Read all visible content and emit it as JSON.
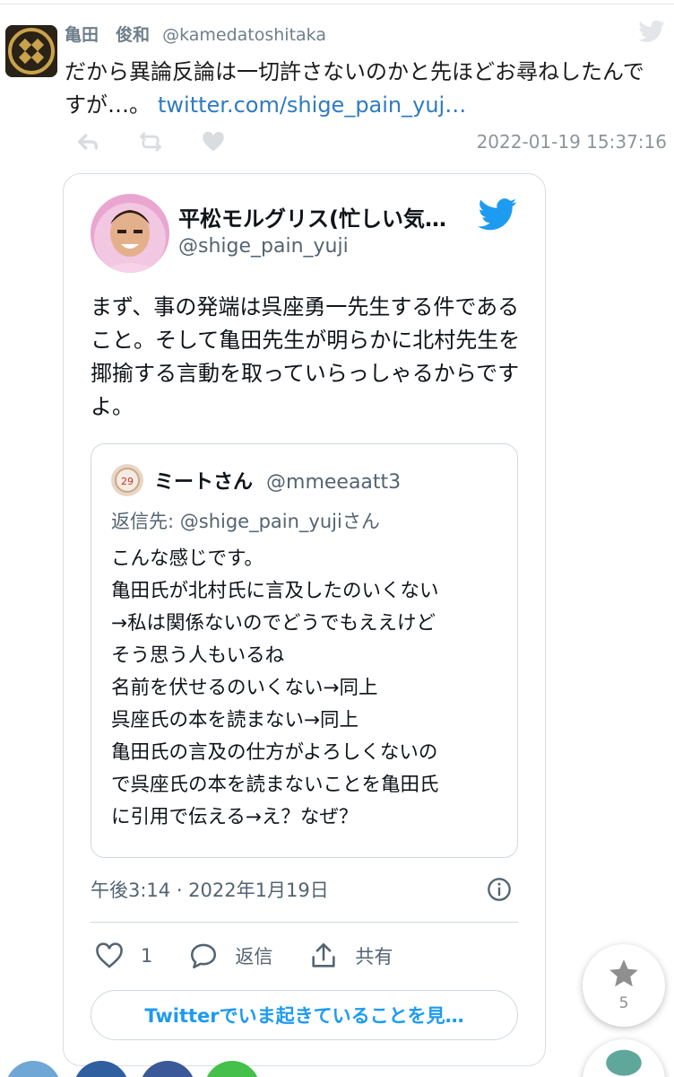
{
  "outer_tweet": {
    "author_name": "亀田　俊和",
    "author_handle": "@kamedatoshitaka",
    "text": "だから異論反論は一切許さないのかと先ほどお尋ねしたんですが…。",
    "link_text": "twitter.com/shige_pain_yuj…",
    "timestamp": "2022-01-19 15:37:16",
    "icons": [
      "reply-icon",
      "retweet-icon",
      "like-icon",
      "twitter-bird-icon"
    ]
  },
  "embedded_tweet": {
    "author_name": "平松モルグリス(忙しい気…",
    "author_handle": "@shige_pain_yuji",
    "text": "まず、事の発端は呉座勇一先生する件であること。そして亀田先生が明らかに北村先生を揶揄する言動を取っていらっしゃるからですよ。",
    "quoted": {
      "author_name": "ミートさん",
      "author_handle": "@mmeeaatt3",
      "reply_to": "返信先: @shige_pain_yujiさん",
      "lines": [
        "こんな感じです。",
        "亀田氏が北村氏に言及したのいくない",
        "→私は関係ないのでどうでもええけど",
        "そう思う人もいるね",
        "名前を伏せるのいくない→同上",
        "呉座氏の本を読まない→同上",
        "亀田氏の言及の仕方がよろしくないの",
        "で呉座氏の本を読まないことを亀田氏",
        "に引用で伝える→え？なぜ？"
      ]
    },
    "date": "午後3:14 · 2022年1月19日",
    "like_count": "1",
    "reply_label": "返信",
    "share_label": "共有",
    "cta_label": "Twitterでいま起きていることを見…"
  },
  "floating": {
    "star_count": "5"
  },
  "colors": {
    "link": "#2f7bc0",
    "twitter_blue": "#1d9bf0",
    "muted": "#536471"
  }
}
